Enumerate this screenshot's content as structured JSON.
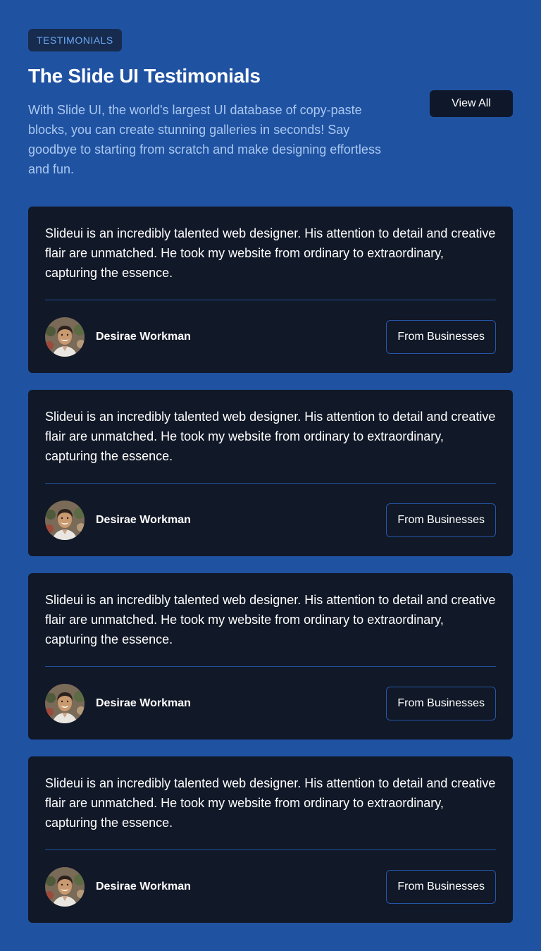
{
  "header": {
    "badge": "TESTIMONIALS",
    "title": "The Slide UI Testimonials",
    "description": "With Slide UI, the world's largest UI database of copy-paste blocks, you can create stunning galleries in seconds! Say goodbye to starting from scratch and make designing effortless and fun.",
    "view_all_label": "View All"
  },
  "testimonials": [
    {
      "quote": "Slideui is an incredibly talented web designer. His attention to detail and creative flair are unmatched. He took my website from ordinary to extraordinary, capturing the essence.",
      "name": "Desirae Workman",
      "tag": "From Businesses",
      "avatar_icon": "person-avatar-photo"
    },
    {
      "quote": "Slideui is an incredibly talented web designer. His attention to detail and creative flair are unmatched. He took my website from ordinary to extraordinary, capturing the essence.",
      "name": "Desirae Workman",
      "tag": "From Businesses",
      "avatar_icon": "person-avatar-photo"
    },
    {
      "quote": "Slideui is an incredibly talented web designer. His attention to detail and creative flair are unmatched. He took my website from ordinary to extraordinary, capturing the essence.",
      "name": "Desirae Workman",
      "tag": "From Businesses",
      "avatar_icon": "person-avatar-photo"
    },
    {
      "quote": "Slideui is an incredibly talented web designer. His attention to detail and creative flair are unmatched. He took my website from ordinary to extraordinary, capturing the essence.",
      "name": "Desirae Workman",
      "tag": "From Businesses",
      "avatar_icon": "person-avatar-photo"
    }
  ],
  "colors": {
    "page_background": "#2052a2",
    "card_background": "#111827",
    "badge_background": "#172b4f",
    "badge_text": "#6aa7f2",
    "description_text": "#a9c8ef",
    "button_dark": "#0f172a",
    "border_blue": "#2557a8"
  }
}
